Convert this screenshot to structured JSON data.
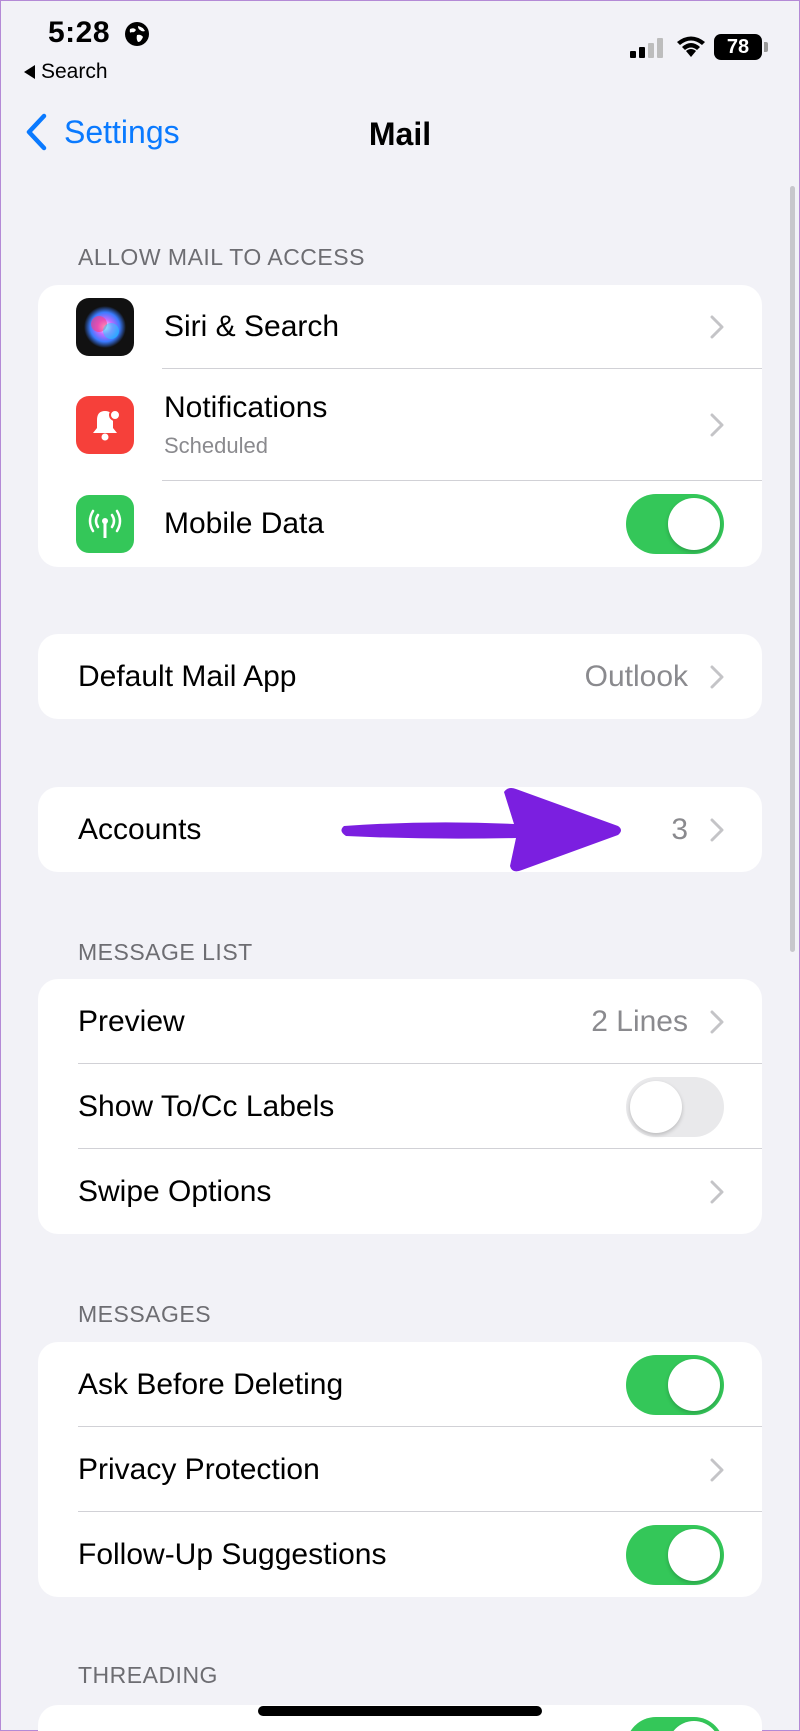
{
  "status_bar": {
    "time": "5:28",
    "back_label": "Search",
    "battery": "78"
  },
  "nav": {
    "back_label": "Settings",
    "title": "Mail"
  },
  "sections": {
    "allow_access": {
      "header": "ALLOW MAIL TO ACCESS",
      "siri": {
        "label": "Siri & Search"
      },
      "notifications": {
        "label": "Notifications",
        "sublabel": "Scheduled"
      },
      "mobile_data": {
        "label": "Mobile Data",
        "toggle": true
      }
    },
    "default_app": {
      "label": "Default Mail App",
      "value": "Outlook"
    },
    "accounts": {
      "label": "Accounts",
      "value": "3"
    },
    "message_list": {
      "header": "MESSAGE LIST",
      "preview": {
        "label": "Preview",
        "value": "2 Lines"
      },
      "show_to_cc": {
        "label": "Show To/Cc Labels",
        "toggle": false
      },
      "swipe_options": {
        "label": "Swipe Options"
      }
    },
    "messages": {
      "header": "MESSAGES",
      "ask_before_deleting": {
        "label": "Ask Before Deleting",
        "toggle": true
      },
      "privacy_protection": {
        "label": "Privacy Protection"
      },
      "follow_up": {
        "label": "Follow-Up Suggestions",
        "toggle": true
      }
    },
    "threading": {
      "header": "THREADING"
    }
  },
  "colors": {
    "accent": "#0a7aff",
    "toggle_on": "#34c759",
    "annotation_arrow": "#7b1fe0",
    "notifications_icon": "#f6403a",
    "mobile_data_icon": "#34c759"
  },
  "icons": [
    "globe-icon",
    "signal-icon",
    "wifi-icon",
    "battery-icon",
    "chevron-left-icon",
    "siri-icon",
    "notifications-icon",
    "antenna-icon",
    "chevron-right-icon",
    "annotation-arrow"
  ]
}
